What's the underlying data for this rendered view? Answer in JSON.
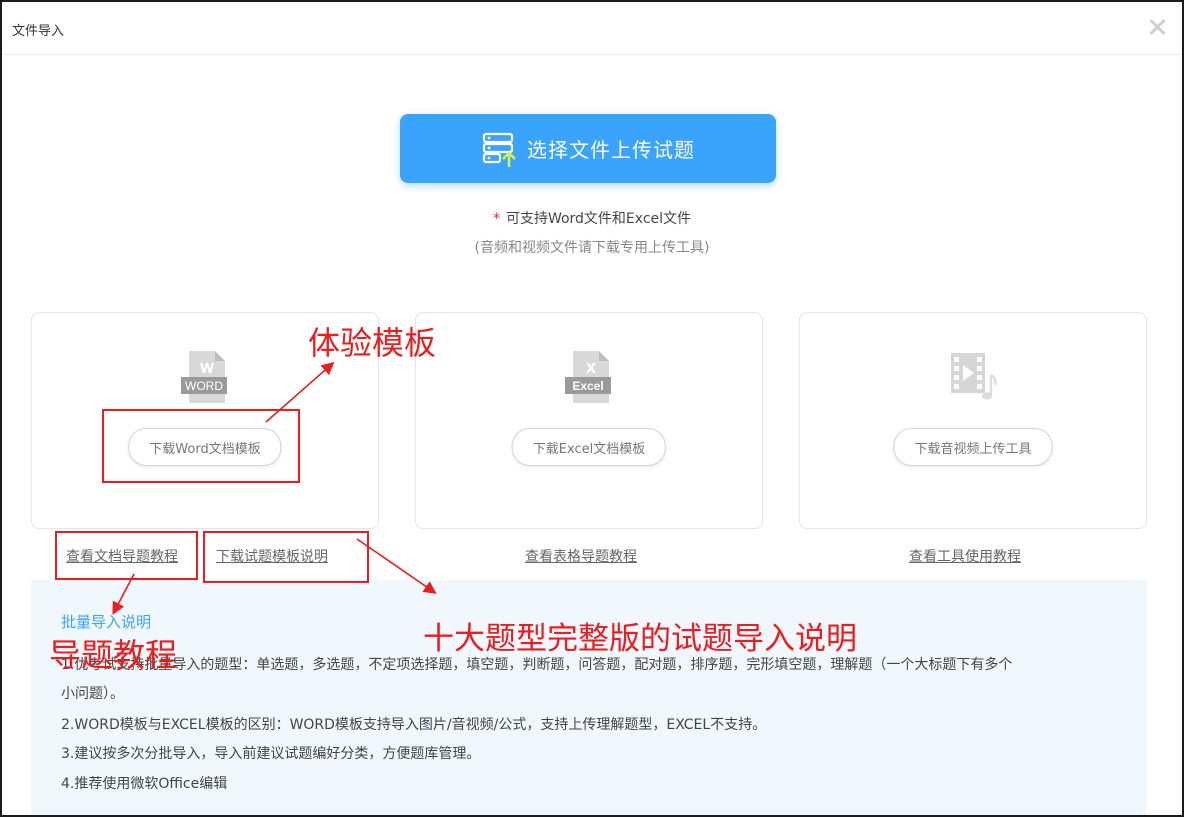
{
  "dialog": {
    "title": "文件导入",
    "close_icon": "close-icon"
  },
  "upload": {
    "label": "选择文件上传试题",
    "icon": "server-upload-icon"
  },
  "support": {
    "star": "*",
    "line": "可支持Word文件和Excel文件",
    "sub": "(音频和视频文件请下载专用上传工具)"
  },
  "cards": [
    {
      "icon": "word-file-icon",
      "icon_text": "WORD",
      "button": "下载Word文档模板"
    },
    {
      "icon": "excel-file-icon",
      "icon_text": "Excel",
      "button": "下载Excel文档模板"
    },
    {
      "icon": "video-audio-icon",
      "button": "下载音视频上传工具"
    }
  ],
  "links": {
    "word_tutorial": "查看文档导题教程",
    "template_explain": "下载试题模板说明",
    "excel_tutorial": "查看表格导题教程",
    "tool_tutorial": "查看工具使用教程"
  },
  "info": {
    "title": "批量导入说明",
    "items": [
      "1.优考试支持批量导入的题型：单选题，多选题，不定项选择题，填空题，判断题，问答题，配对题，排序题，完形填空题，理解题（一个大标题下有多个",
      "小问题）。",
      "2.WORD模板与EXCEL模板的区别：WORD模板支持导入图片/音视频/公式，支持上传理解题型，EXCEL不支持。",
      "3.建议按多次分批导入，导入前建议试题编好分类，方便题库管理。",
      "4.推荐使用微软Office编辑"
    ]
  },
  "annotations": {
    "template": "体验模板",
    "tutorial": "导题教程",
    "explain": "十大题型完整版的试题导入说明",
    "color": "#ee1c1c"
  },
  "colors": {
    "primary": "#3aa3fb",
    "info_bg": "#f0f7fd"
  }
}
